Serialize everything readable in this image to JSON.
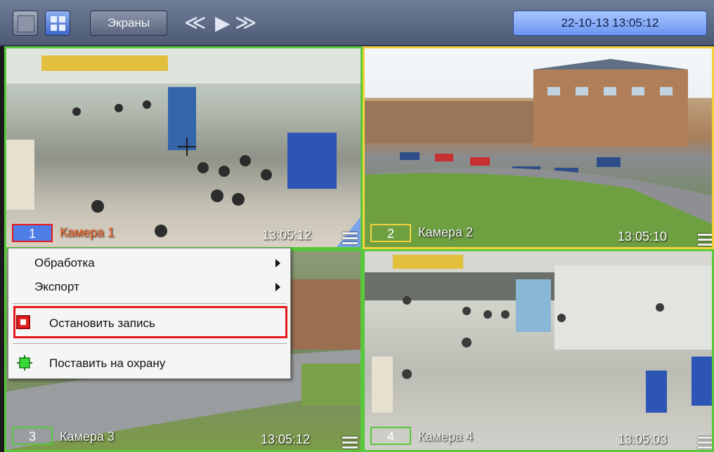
{
  "toolbar": {
    "screens_label": "Экраны",
    "nav_back": "≪",
    "nav_play": "▶",
    "nav_forward": "≫",
    "clock": "22-10-13  13:05:12",
    "icons": [
      "single-view-icon",
      "grid-view-icon"
    ]
  },
  "cameras": [
    {
      "number": "1",
      "name": "Камера 1",
      "time": "13:05:12",
      "number_color": "#4f7de6",
      "name_color": "#ff6a2a"
    },
    {
      "number": "2",
      "name": "Камера 2",
      "time": "13:05:10",
      "number_color": "#f2d23b"
    },
    {
      "number": "3",
      "name": "Камера 3",
      "time": "13:05:12",
      "number_color": "#58c83d"
    },
    {
      "number": "4",
      "name": "Камера 4",
      "time": "13:05:03",
      "number_color": "#58c83d"
    }
  ],
  "context_menu": {
    "items": [
      {
        "label": "Обработка",
        "has_submenu": true
      },
      {
        "label": "Экспорт",
        "has_submenu": true
      },
      {
        "label": "Остановить запись",
        "icon": "stop-record-icon",
        "highlighted": true
      },
      {
        "label": "Поставить на охрану",
        "icon": "arm-icon"
      }
    ]
  },
  "colors": {
    "active_border": "#58c83d",
    "selected_border": "#f2d23b",
    "highlight": "#e8191e"
  }
}
